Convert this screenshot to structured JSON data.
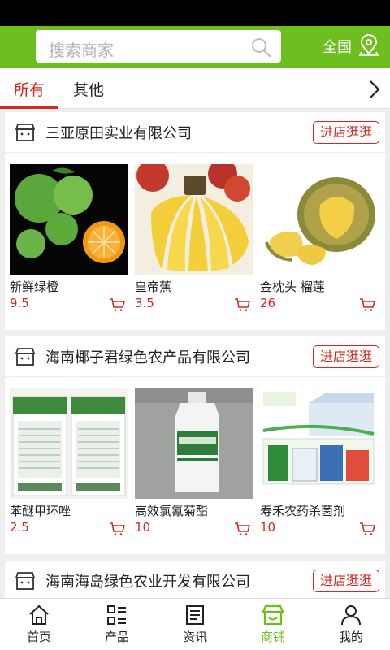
{
  "search": {
    "placeholder": "搜索商家"
  },
  "region": {
    "label": "全国"
  },
  "tabs": [
    {
      "label": "所有"
    },
    {
      "label": "其他"
    }
  ],
  "shops": [
    {
      "name": "三亚原田实业有限公司",
      "visit_label": "进店逛逛",
      "products": [
        {
          "name": "新鲜绿橙",
          "price": "9.5"
        },
        {
          "name": "皇帝蕉",
          "price": "3.5"
        },
        {
          "name": "金枕头 榴莲",
          "price": "26"
        }
      ]
    },
    {
      "name": "海南椰子君绿色农产品有限公司",
      "visit_label": "进店逛逛",
      "products": [
        {
          "name": "苯醚甲环唑",
          "price": "2.5"
        },
        {
          "name": "高效氯氰菊酯",
          "price": "10"
        },
        {
          "name": "寿禾农药杀菌剂",
          "price": "10"
        }
      ]
    },
    {
      "name": "海南海岛绿色农业开发有限公司",
      "visit_label": "进店逛逛"
    }
  ],
  "bottom_nav": [
    {
      "label": "首页",
      "icon": "home-icon"
    },
    {
      "label": "产品",
      "icon": "list-icon"
    },
    {
      "label": "资讯",
      "icon": "news-icon"
    },
    {
      "label": "商铺",
      "icon": "shop-icon",
      "active": true
    },
    {
      "label": "我的",
      "icon": "user-icon"
    }
  ],
  "colors": {
    "brand_green": "#6dbe1f",
    "accent_red": "#d9261c"
  }
}
